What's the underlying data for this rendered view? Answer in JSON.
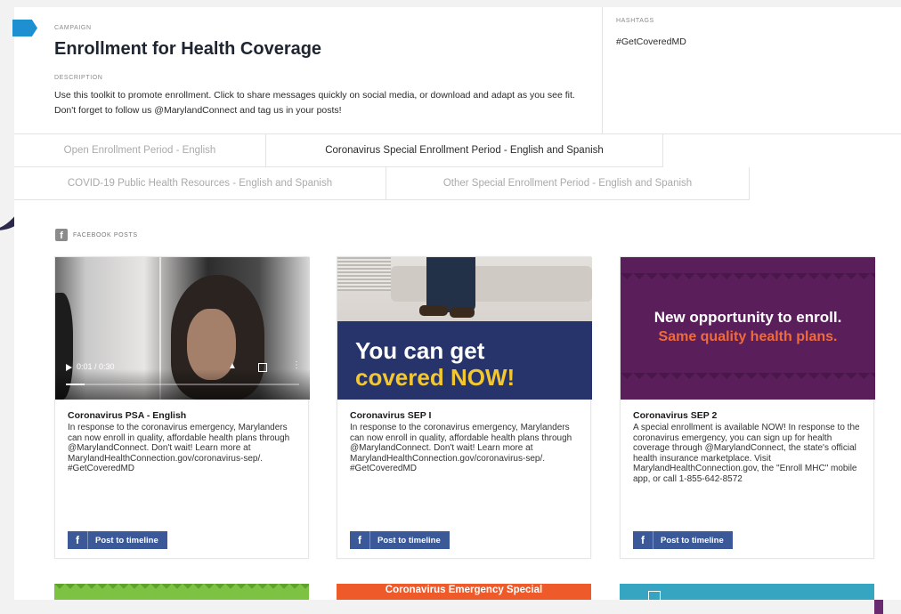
{
  "campaign": {
    "label": "CAMPAIGN",
    "title": "Enrollment for Health Coverage",
    "description_label": "DESCRIPTION",
    "description": "Use this toolkit to promote enrollment. Click to share messages quickly on social media, or download and adapt as you see fit. Don't forget to follow us @MarylandConnect and tag us in your posts!"
  },
  "hashtags": {
    "label": "HASHTAGS",
    "value": "#GetCoveredMD"
  },
  "tabs": [
    {
      "label": "Open Enrollment Period - English",
      "active": false
    },
    {
      "label": "Coronavirus Special Enrollment Period - English and Spanish",
      "active": true
    },
    {
      "label": "COVID-19 Public Health Resources - English and Spanish",
      "active": false
    },
    {
      "label": "Other Special Enrollment Period - English and Spanish",
      "active": false
    }
  ],
  "facebook_section": {
    "icon": "facebook-icon",
    "label": "FACEBOOK POSTS"
  },
  "cards": [
    {
      "media": {
        "type": "video",
        "time": "0:01 / 0:30",
        "progress": 0.08
      },
      "title": "Coronavirus PSA - English",
      "body": "In response to the coronavirus emergency, Marylanders can now enroll in quality, affordable health plans through @MarylandConnect. Don't wait! Learn more at MarylandHealthConnection.gov/coronavirus-sep/. #GetCoveredMD",
      "button": "Post to timeline"
    },
    {
      "media": {
        "type": "image",
        "line1": "You can get",
        "line2_prefix": "covered ",
        "line2_emph": "NOW!"
      },
      "title": "Coronavirus SEP I",
      "body": "In response to the coronavirus emergency, Marylanders can now enroll in quality, affordable health plans through @MarylandConnect. Don't wait! Learn more at MarylandHealthConnection.gov/coronavirus-sep/. #GetCoveredMD",
      "button": "Post to timeline"
    },
    {
      "media": {
        "type": "image",
        "line1": "New opportunity to enroll.",
        "line2": "Same quality health plans."
      },
      "title": "Coronavirus SEP 2",
      "body": "A special enrollment is available NOW! In response to the coronavirus emergency, you can sign up for health coverage through @MarylandConnect, the state's official health insurance marketplace. Visit MarylandHealthConnection.gov, the \"Enroll MHC\" mobile app, or call 1-855-642-8572",
      "button": "Post to timeline"
    }
  ],
  "bottom_row": [
    {
      "color": "#7ec243"
    },
    {
      "color": "#ef5a2b",
      "text": "Coronavirus Emergency Special"
    },
    {
      "color": "#35a5c2"
    }
  ],
  "colors": {
    "facebook_blue": "#3b5998",
    "campaign_marker": "#1e8fd0",
    "sep1_navy": "#26346b",
    "sep1_yellow": "#f3c730",
    "sep2_purple": "#5a1e5a",
    "sep2_orange": "#f06a3a"
  }
}
